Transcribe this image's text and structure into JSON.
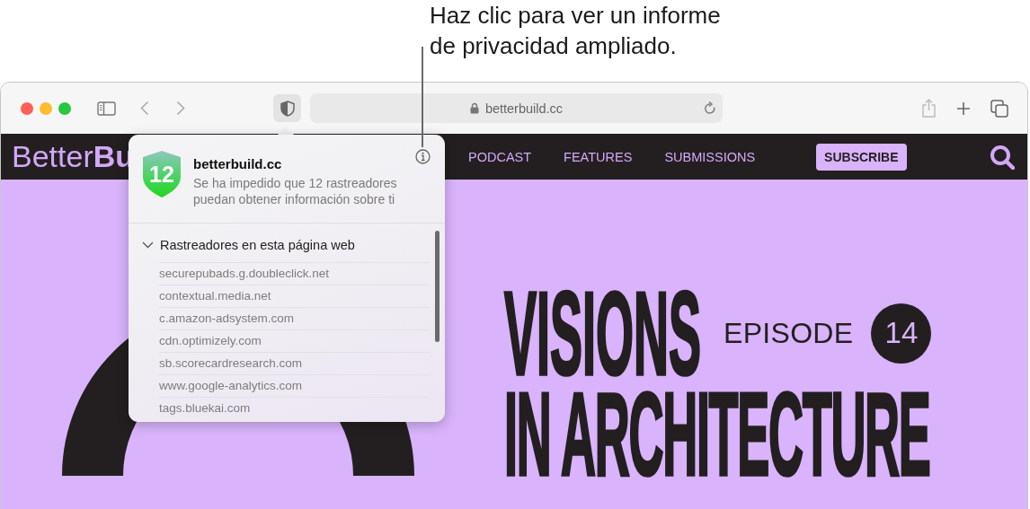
{
  "callout": {
    "text": "Haz clic para ver un informe de privacidad ampliado."
  },
  "toolbar": {
    "privacy_button": {
      "selected": true
    },
    "address": "betterbuild.cc"
  },
  "site_nav": {
    "logo": "Better**Bu**",
    "links": [
      "PODCAST",
      "FEATURES",
      "SUBMISSIONS"
    ],
    "subscribe": "SUBSCRIBE"
  },
  "hero": {
    "title_lines": [
      "VISIONS",
      "IN ARCHITECTURE"
    ],
    "episode_label": "EPISODE",
    "episode_number": "14"
  },
  "privacy_popover": {
    "badge": "12",
    "site": "betterbuild.cc",
    "summary": "Se ha impedido que 12 rastreadores puedan obtener información sobre ti",
    "section": {
      "title": "Rastreadores en esta página web",
      "expanded": true,
      "trackers": [
        "securepubads.g.doubleclick.net",
        "contextual.media.net",
        "c.amazon-adsystem.com",
        "cdn.optimizely.com",
        "sb.scorecardresearch.com",
        "www.google-analytics.com",
        "tags.bluekai.com"
      ]
    }
  }
}
